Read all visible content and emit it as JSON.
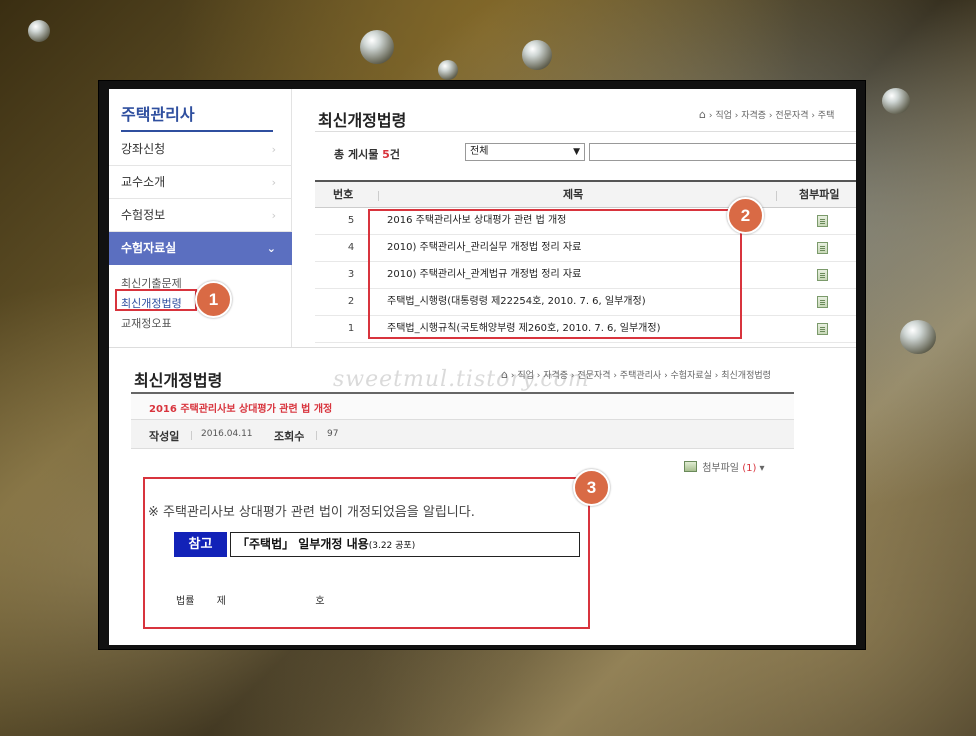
{
  "sidebar": {
    "title": "주택관리사",
    "items": [
      {
        "label": "강좌신청"
      },
      {
        "label": "교수소개"
      },
      {
        "label": "수험정보"
      },
      {
        "label": "수험자료실"
      }
    ],
    "sub_items": [
      {
        "label": "최신기출문제"
      },
      {
        "label": "최신개정법령"
      },
      {
        "label": "교재정오표"
      }
    ]
  },
  "list": {
    "title": "최신개정법령",
    "breadcrumb": "› 직업 › 자격증 › 전문자격 › 주택",
    "count_prefix": "총 게시물",
    "count_num": "5",
    "count_suffix": "건",
    "filter_selected": "전체",
    "columns": {
      "no": "번호",
      "title": "제목",
      "attach": "첨부파일"
    },
    "rows": [
      {
        "no": "5",
        "title": "2016 주택관리사보 상대평가 관련 법 개정"
      },
      {
        "no": "4",
        "title": "2010) 주택관리사_관리실무 개정법 정리 자료"
      },
      {
        "no": "3",
        "title": "2010) 주택관리사_관계법규 개정법 정리 자료"
      },
      {
        "no": "2",
        "title": "주택법_시행령(대통령령 제22254호, 2010. 7. 6, 일부개정)"
      },
      {
        "no": "1",
        "title": "주택법_시행규칙(국토해양부령 제260호, 2010. 7. 6, 일부개정)"
      }
    ]
  },
  "detail": {
    "title": "최신개정법령",
    "breadcrumb": "› 직업 › 자격증 › 전문자격 › 주택관리사 › 수험자료실 › 최신개정법령",
    "watermark": "sweetmul.tistory.com",
    "post_title": "2016 주택관리사보 상대평가 관련 법 개정",
    "date_label": "작성일",
    "date_value": "2016.04.11",
    "views_label": "조회수",
    "views_value": "97",
    "attach_label": "첨부파일",
    "attach_count": "(1)",
    "attach_caret": "▾",
    "notice": "※ 주택관리사보 상대평가 관련 법이 개정되었음을 알립니다.",
    "ref_tag": "참고",
    "ref_text": "「주택법」 일부개정 내용",
    "ref_small": "(3.22 공포)",
    "law_line": "법률  제        호"
  },
  "callouts": {
    "one": "1",
    "two": "2",
    "three": "3"
  },
  "colors": {
    "accent": "#5b6fc0",
    "callout": "#d8343d",
    "badge": "#d96a45",
    "ref_tag": "#1222b8"
  }
}
